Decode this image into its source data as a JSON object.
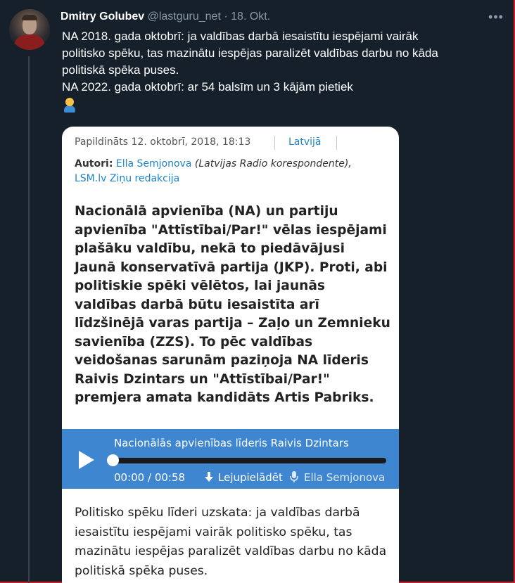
{
  "tweet": {
    "author_name": "Dmitry Golubev",
    "author_handle": "@lastguru_net",
    "separator": "·",
    "date": "18. Okt.",
    "text_lines": [
      "NA 2018. gada oktobrī: ja valdības darbā iesaistītu iespējami vairāk",
      "politisko spēku, tas mazinātu iespējas paralizēt valdības darbu no kāda",
      "politiskā spēka puses.",
      "NA 2022. gada oktobrī: ar 54 balsīm un 3 kājām pietiek"
    ],
    "emoji": "man-shrugging-emoji"
  },
  "article": {
    "added": "Papildināts 12. oktobrī, 2018, 18:13",
    "category": "Latvijā",
    "authors_label": "Autori:",
    "author_primary": "Ella Semjonova",
    "author_role": "(Latvijas Radio korespondente),",
    "author_secondary": "LSM.lv Ziņu redakcija",
    "lead_lines": [
      "Nacionālā apvienība (NA) un partiju",
      "apvienība \"Attīstībai/Par!\" vēlas iespējami",
      "plašāku valdību, nekā to piedāvājusi",
      "Jaunā konservatīvā partija (JKP). Proti, abi",
      "politiskie spēki vēlētos, lai jaunās",
      "valdības darbā būtu iesaistīta arī",
      "līdzšinējā varas partija – Zaļo un Zemnieku",
      "savienība (ZZS). To pēc valdības",
      "veidošanas sarunām paziņoja NA līderis",
      "Raivis Dzintars un \"Attīstībai/Par!\"",
      "premjera amata kandidāts Artis Pabriks."
    ],
    "audio": {
      "title": "Nacionālās apvienības līderis Raivis Dzintars",
      "time": "00:00 / 00:58",
      "download_label": "Lejupielādēt",
      "author": "Ella Semjonova",
      "progress": 0
    },
    "body_lines": [
      "Politisko spēku līderi uzskata: ja valdības darbā",
      "iesaistītu iespējami vairāk politisko spēku, tas",
      "mazinātu iespējas paralizēt valdības darbu no kāda",
      "politiskā spēka puses."
    ]
  },
  "colors": {
    "background": "#15202b",
    "link": "#1f84c7",
    "player": "#3e86d0",
    "muted": "#8b98a5"
  }
}
